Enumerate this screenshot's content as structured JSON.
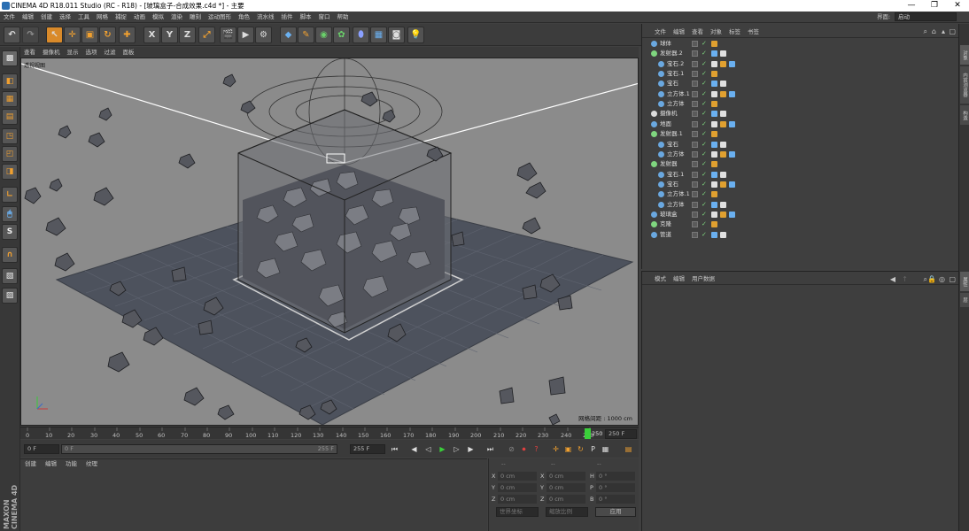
{
  "window": {
    "title": "CINEMA 4D R18.011 Studio (RC - R18) - [玻璃盒子-合成效果.c4d *] - 主要",
    "min": "—",
    "max": "❐",
    "close": "✕"
  },
  "menu": [
    "文件",
    "编辑",
    "创建",
    "选择",
    "工具",
    "网格",
    "捕捉",
    "动画",
    "模拟",
    "渲染",
    "雕刻",
    "运动图形",
    "角色",
    "流水线",
    "插件",
    "脚本",
    "窗口",
    "帮助"
  ],
  "layout": {
    "label": "界面:",
    "value": "启动"
  },
  "viewport": {
    "menu": [
      "查看",
      "摄像机",
      "显示",
      "选项",
      "过滤",
      "面板"
    ],
    "label": "透视视图",
    "grid_info": "网格间距 : 1000 cm"
  },
  "timeline": {
    "ticks": [
      "0",
      "10",
      "20",
      "30",
      "40",
      "50",
      "60",
      "70",
      "80",
      "90",
      "100",
      "110",
      "120",
      "130",
      "140",
      "150",
      "160",
      "170",
      "180",
      "190",
      "200",
      "210",
      "220",
      "230",
      "240",
      "250"
    ],
    "current": "250",
    "end_field": "250 F"
  },
  "playback": {
    "start": "0 F",
    "range_start": "0 F",
    "range_end": "255 F",
    "end": "255 F"
  },
  "materials": {
    "menu": [
      "创建",
      "编辑",
      "功能",
      "纹理"
    ]
  },
  "coords": {
    "header": [
      "--",
      "--",
      "--"
    ],
    "rows": [
      {
        "a": "X",
        "av": "0 cm",
        "b": "X",
        "bv": "0 cm",
        "c": "H",
        "cv": "0 °"
      },
      {
        "a": "Y",
        "av": "0 cm",
        "b": "Y",
        "bv": "0 cm",
        "c": "P",
        "cv": "0 °"
      },
      {
        "a": "Z",
        "av": "0 cm",
        "b": "Z",
        "bv": "0 cm",
        "c": "B",
        "cv": "0 °"
      }
    ],
    "world": "世界坐标",
    "scale": "缩放比例",
    "apply": "应用"
  },
  "objects": {
    "menu": [
      "文件",
      "编辑",
      "查看",
      "对象",
      "标签",
      "书签"
    ],
    "items": [
      {
        "name": "球体",
        "indent": 0,
        "color": "#6aa8e0"
      },
      {
        "name": "发射器.2",
        "indent": 0,
        "color": "#7fd67f"
      },
      {
        "name": "宝石.2",
        "indent": 1,
        "color": "#6aa8e0"
      },
      {
        "name": "宝石.1",
        "indent": 1,
        "color": "#6aa8e0"
      },
      {
        "name": "宝石",
        "indent": 1,
        "color": "#6aa8e0"
      },
      {
        "name": "立方体.1",
        "indent": 1,
        "color": "#6aa8e0"
      },
      {
        "name": "立方体",
        "indent": 1,
        "color": "#6aa8e0"
      },
      {
        "name": "摄像机",
        "indent": 0,
        "color": "#dddddd"
      },
      {
        "name": "地面",
        "indent": 0,
        "color": "#6aa8e0"
      },
      {
        "name": "发射器.1",
        "indent": 0,
        "color": "#7fd67f"
      },
      {
        "name": "宝石",
        "indent": 1,
        "color": "#6aa8e0"
      },
      {
        "name": "立方体",
        "indent": 1,
        "color": "#6aa8e0"
      },
      {
        "name": "发射器",
        "indent": 0,
        "color": "#7fd67f"
      },
      {
        "name": "宝石.1",
        "indent": 1,
        "color": "#6aa8e0"
      },
      {
        "name": "宝石",
        "indent": 1,
        "color": "#6aa8e0"
      },
      {
        "name": "立方体.1",
        "indent": 1,
        "color": "#6aa8e0"
      },
      {
        "name": "立方体",
        "indent": 1,
        "color": "#6aa8e0"
      },
      {
        "name": "玻璃盒",
        "indent": 0,
        "color": "#6aa8e0"
      },
      {
        "name": "克隆",
        "indent": 0,
        "color": "#7fd67f"
      },
      {
        "name": "管道",
        "indent": 0,
        "color": "#6aa8e0"
      }
    ]
  },
  "attributes": {
    "menu": [
      "模式",
      "编辑",
      "用户数据"
    ]
  },
  "right_tabs": [
    "对象",
    "内容浏览器",
    "构造",
    "属性",
    "层"
  ],
  "brand": "MAXON CINEMA 4D"
}
